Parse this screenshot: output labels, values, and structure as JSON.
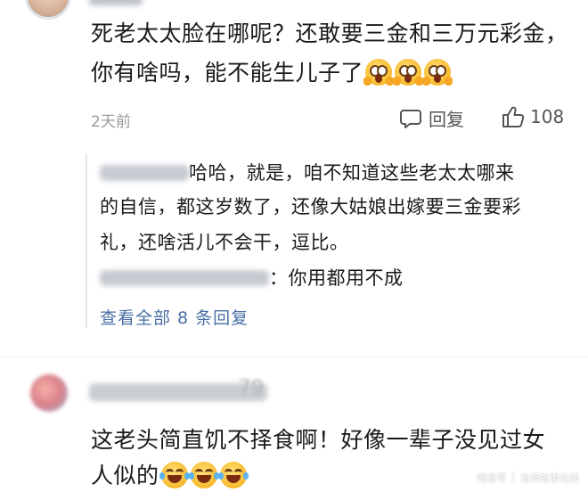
{
  "comment1": {
    "text": "死老太太脸在哪呢？还敢要三金和三万元彩金，你有啥吗，能不能生儿子了",
    "time": "2天前",
    "reply_label": "回复",
    "like_count": "108"
  },
  "replies": {
    "line1": "哈哈，就是，咱不知道这些老太太哪来",
    "line2": "的自信，都这岁数了，还像大姑娘出嫁要三金要彩",
    "line3": "礼，还啥活儿不会干，逗比。",
    "line4_prefix": "：",
    "line4_text": "你用都用不成",
    "view_more": "查看全部 8 条回复"
  },
  "comment2": {
    "name_tail": "79",
    "text": "这老头简直饥不择食啊！好像一辈子没见过女人似的"
  },
  "watermark": {
    "brand": "网易号",
    "source": "法律故事在线"
  },
  "colors": {
    "link": "#4a6fa5",
    "meta": "#9a9a9a"
  }
}
